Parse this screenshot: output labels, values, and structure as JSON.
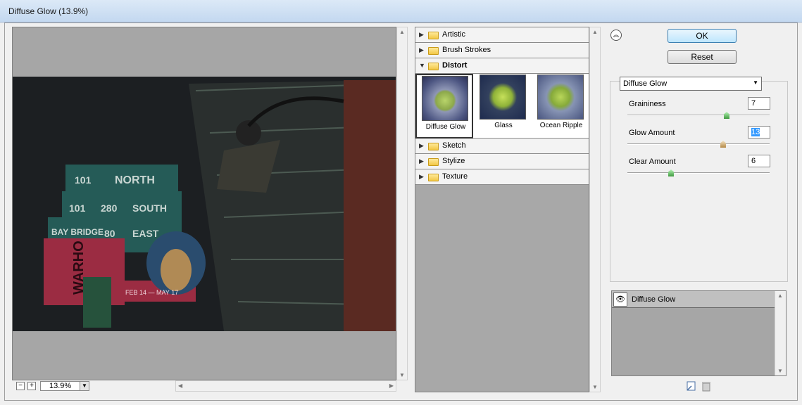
{
  "window": {
    "title": "Diffuse Glow (13.9%)"
  },
  "zoom": {
    "value": "13.9%",
    "minus_label": "−",
    "plus_label": "+"
  },
  "categories": [
    {
      "label": "Artistic",
      "expanded": false
    },
    {
      "label": "Brush Strokes",
      "expanded": false
    },
    {
      "label": "Distort",
      "expanded": true
    },
    {
      "label": "Sketch",
      "expanded": false
    },
    {
      "label": "Stylize",
      "expanded": false
    },
    {
      "label": "Texture",
      "expanded": false
    }
  ],
  "distort_filters": [
    {
      "label": "Diffuse Glow",
      "selected": true
    },
    {
      "label": "Glass",
      "selected": false
    },
    {
      "label": "Ocean Ripple",
      "selected": false
    }
  ],
  "buttons": {
    "ok": "OK",
    "reset": "Reset"
  },
  "filter_select": {
    "value": "Diffuse Glow"
  },
  "params": [
    {
      "label": "Graininess",
      "value": "7",
      "level": 0.7
    },
    {
      "label": "Glow Amount",
      "value": "13",
      "level": 0.65
    },
    {
      "label": "Clear Amount",
      "value": "6",
      "level": 0.3
    }
  ],
  "layer": {
    "label": "Diffuse Glow"
  },
  "preview_sign": {
    "route1": "101",
    "dir1": "NORTH",
    "route2": "101",
    "route3": "280",
    "dir2": "SOUTH",
    "place": "BAY BRIDGE",
    "route4": "80",
    "dir3": "EAST",
    "banner1": "WARHO",
    "banner2": "FEB 14 — MAY 17"
  },
  "icons": {
    "collapse": "double-chevron-up-icon",
    "eye": "eye-icon",
    "folder": "folder-icon",
    "new_layer": "new-effect-layer-icon",
    "delete": "trash-icon"
  }
}
